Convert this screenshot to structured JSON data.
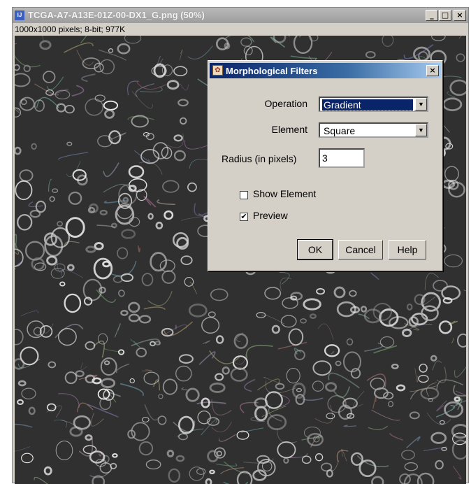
{
  "window": {
    "title": "TCGA-A7-A13E-01Z-00-DX1_G.png (50%)",
    "info": "1000x1000 pixels; 8-bit; 977K",
    "minimize": "_",
    "maximize": "□",
    "close": "×"
  },
  "dialog": {
    "title": "Morphological Filters",
    "close": "×",
    "operation_label": "Operation",
    "operation_value": "Gradient",
    "element_label": "Element",
    "element_value": "Square",
    "radius_label": "Radius (in pixels)",
    "radius_value": "3",
    "show_element_label": "Show Element",
    "show_element_checked": false,
    "preview_label": "Preview",
    "preview_checked": true,
    "preview_mark": "✔",
    "ok_label": "OK",
    "cancel_label": "Cancel",
    "help_label": "Help"
  },
  "icons": {
    "app": "imagej-icon",
    "dialog": "plugin-icon",
    "combo_arrow": "▼"
  }
}
